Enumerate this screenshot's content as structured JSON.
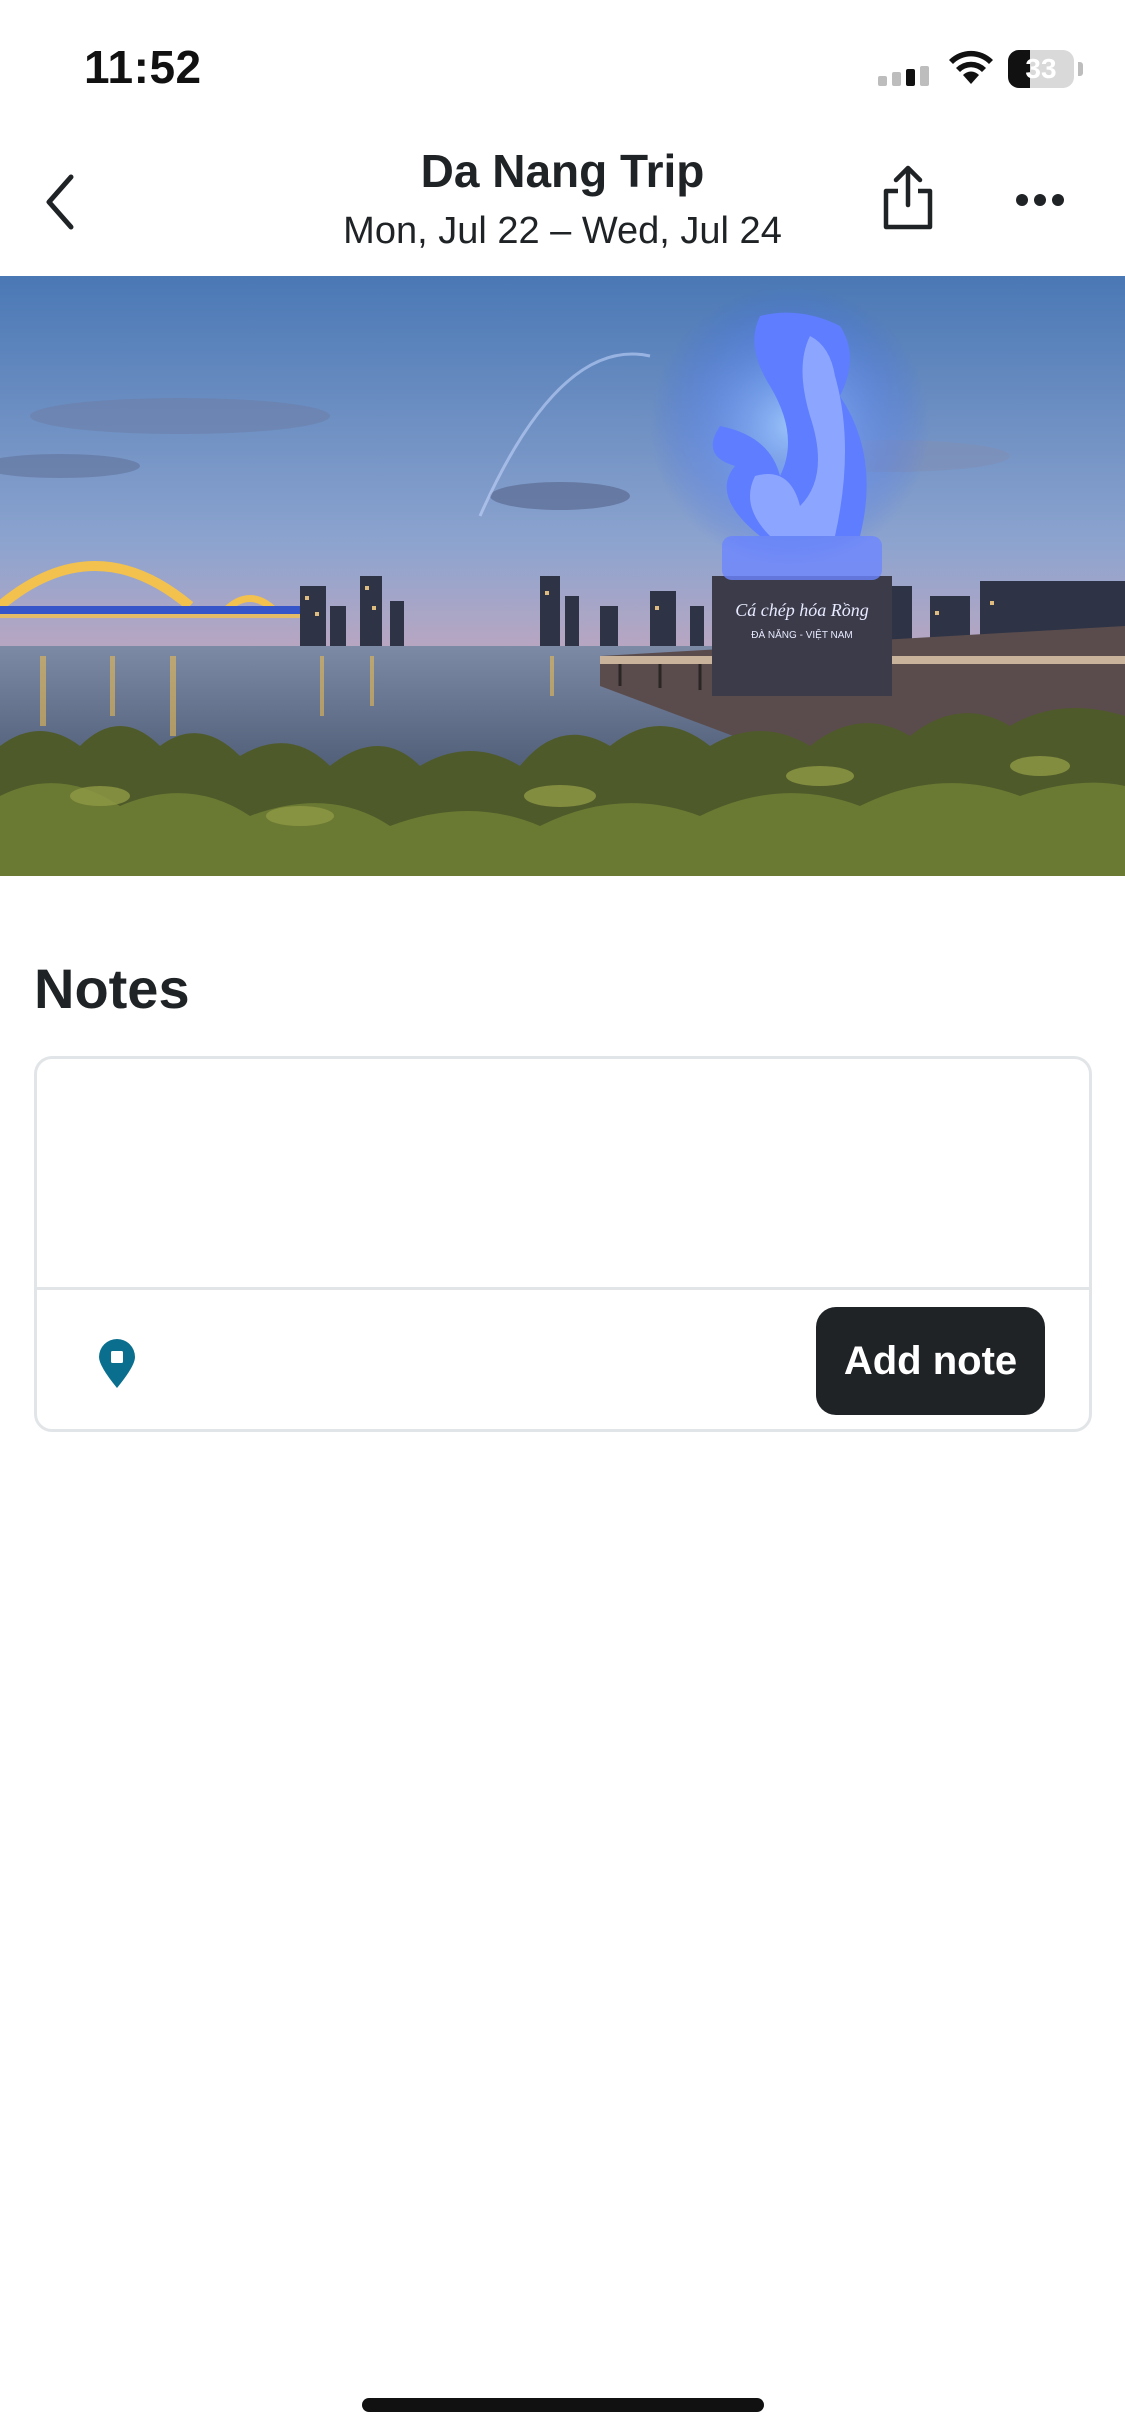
{
  "status_bar": {
    "time": "11:52",
    "battery_level": "33",
    "battery_fraction": 0.33
  },
  "header": {
    "title": "Da Nang Trip",
    "subtitle": "Mon, Jul 22 – Wed, Jul 24",
    "back_icon": "chevron-left-icon",
    "share_icon": "share-icon",
    "more_icon": "more-horizontal-icon"
  },
  "hero": {
    "description_icon": "photo",
    "sign_text": "Cá chép hóa Rồng",
    "sign_subtext": "ĐÀ NẴNG - VIỆT NAM"
  },
  "notes": {
    "heading": "Notes",
    "placeholder": "",
    "add_button_label": "Add note",
    "location_icon": "map-pin-icon",
    "accent_color": "#0a6f8e"
  },
  "colors": {
    "text": "#1f2326",
    "button_bg": "#1f2326",
    "border": "#e2e5e8"
  }
}
